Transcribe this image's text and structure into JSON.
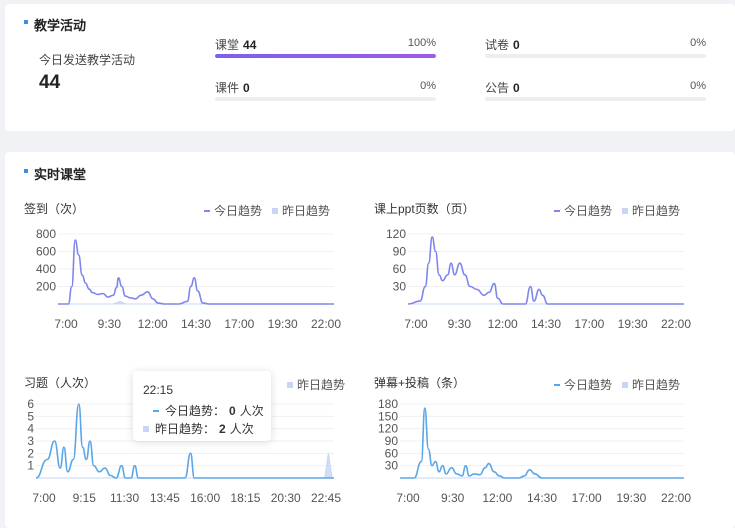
{
  "activity": {
    "title": "教学活动",
    "total_label": "今日发送教学活动",
    "total_value": "44",
    "stats": [
      {
        "label": "课堂",
        "value": "44",
        "percent": "100%",
        "fill": 1.0
      },
      {
        "label": "课件",
        "value": "0",
        "percent": "0%",
        "fill": 0
      },
      {
        "label": "试卷",
        "value": "0",
        "percent": "0%",
        "fill": 0
      },
      {
        "label": "公告",
        "value": "0",
        "percent": "0%",
        "fill": 0
      }
    ]
  },
  "live": {
    "title": "实时课堂"
  },
  "legend": {
    "today": "今日趋势",
    "yesterday": "昨日趋势"
  },
  "colors": {
    "purple": "#7f86ec",
    "blue": "#5aa6e8",
    "yesterday": "#c7d6f4",
    "bar_fill": "#8b5cf6"
  },
  "tooltip": {
    "time": "22:15",
    "today_label": "今日趋势：",
    "today_value": "0",
    "yesterday_label": "昨日趋势：",
    "yesterday_value": "2",
    "unit": "人次"
  },
  "chart_data": [
    {
      "type": "line",
      "title": "签到（次）",
      "series": [
        {
          "name": "今日趋势",
          "color": "#7f86ec"
        },
        {
          "name": "昨日趋势",
          "color": "#c7d6f4"
        }
      ],
      "y_ticks": [
        "800",
        "600",
        "400",
        "200"
      ],
      "ylim": [
        0,
        800
      ],
      "x_ticks": [
        "7:00",
        "9:30",
        "12:00",
        "14:30",
        "17:00",
        "19:30",
        "22:00"
      ],
      "today": [
        [
          7.0,
          0
        ],
        [
          7.6,
          0
        ],
        [
          7.8,
          200
        ],
        [
          8.0,
          730
        ],
        [
          8.2,
          560
        ],
        [
          8.4,
          330
        ],
        [
          8.6,
          240
        ],
        [
          8.8,
          170
        ],
        [
          9.0,
          130
        ],
        [
          9.3,
          110
        ],
        [
          9.6,
          120
        ],
        [
          9.9,
          80
        ],
        [
          10.2,
          100
        ],
        [
          10.4,
          190
        ],
        [
          10.5,
          300
        ],
        [
          10.7,
          200
        ],
        [
          10.9,
          90
        ],
        [
          11.2,
          70
        ],
        [
          11.5,
          60
        ],
        [
          11.8,
          100
        ],
        [
          12.2,
          140
        ],
        [
          12.5,
          60
        ],
        [
          12.8,
          10
        ],
        [
          13.2,
          0
        ],
        [
          14.0,
          0
        ],
        [
          14.5,
          30
        ],
        [
          14.7,
          200
        ],
        [
          14.9,
          300
        ],
        [
          15.1,
          150
        ],
        [
          15.4,
          10
        ],
        [
          15.8,
          0
        ],
        [
          23.0,
          0
        ]
      ],
      "yesterday": [
        [
          7.0,
          0
        ],
        [
          10.2,
          0
        ],
        [
          10.6,
          30
        ],
        [
          10.9,
          0
        ],
        [
          23.0,
          0
        ]
      ]
    },
    {
      "type": "line",
      "title": "课上ppt页数（页）",
      "series": [
        {
          "name": "今日趋势",
          "color": "#7f86ec"
        },
        {
          "name": "昨日趋势",
          "color": "#c7d6f4"
        }
      ],
      "y_ticks": [
        "120",
        "90",
        "60",
        "30"
      ],
      "ylim": [
        0,
        120
      ],
      "x_ticks": [
        "7:00",
        "9:30",
        "12:00",
        "14:30",
        "17:00",
        "19:30",
        "22:00"
      ],
      "today": [
        [
          7.0,
          0
        ],
        [
          7.7,
          5
        ],
        [
          8.0,
          30
        ],
        [
          8.2,
          70
        ],
        [
          8.4,
          115
        ],
        [
          8.6,
          90
        ],
        [
          8.8,
          50
        ],
        [
          9.0,
          40
        ],
        [
          9.3,
          50
        ],
        [
          9.5,
          70
        ],
        [
          9.7,
          50
        ],
        [
          10.0,
          70
        ],
        [
          10.3,
          50
        ],
        [
          10.6,
          30
        ],
        [
          11.0,
          25
        ],
        [
          11.4,
          15
        ],
        [
          11.7,
          20
        ],
        [
          12.0,
          35
        ],
        [
          12.2,
          10
        ],
        [
          12.5,
          0
        ],
        [
          13.8,
          0
        ],
        [
          14.1,
          30
        ],
        [
          14.3,
          5
        ],
        [
          14.6,
          25
        ],
        [
          14.8,
          15
        ],
        [
          15.1,
          0
        ],
        [
          23.0,
          0
        ]
      ],
      "yesterday": [
        [
          7.0,
          0
        ],
        [
          23.0,
          0
        ]
      ]
    },
    {
      "type": "line",
      "title": "习题（人次）",
      "series": [
        {
          "name": "昨日趋势",
          "color": "#c7d6f4"
        }
      ],
      "y_ticks": [
        "6",
        "5",
        "4",
        "3",
        "2",
        "1"
      ],
      "ylim": [
        0,
        6
      ],
      "x_ticks": [
        "7:00",
        "9:15",
        "11:30",
        "13:45",
        "16:00",
        "18:15",
        "20:30",
        "22:45"
      ],
      "today": [
        [
          7.0,
          0
        ],
        [
          7.6,
          1.5
        ],
        [
          8.0,
          3.0
        ],
        [
          8.3,
          0.8
        ],
        [
          8.5,
          2.5
        ],
        [
          8.7,
          0.5
        ],
        [
          9.0,
          1.5
        ],
        [
          9.3,
          6.0
        ],
        [
          9.5,
          2.5
        ],
        [
          9.7,
          1.5
        ],
        [
          9.9,
          3.0
        ],
        [
          10.1,
          1.0
        ],
        [
          10.4,
          0.5
        ],
        [
          10.7,
          0.8
        ],
        [
          11.0,
          0.2
        ],
        [
          11.3,
          0
        ],
        [
          11.6,
          1.0
        ],
        [
          11.8,
          0
        ],
        [
          12.1,
          0
        ],
        [
          12.3,
          1.0
        ],
        [
          12.5,
          0
        ],
        [
          15.0,
          0
        ],
        [
          15.3,
          2.0
        ],
        [
          15.5,
          0
        ],
        [
          23.0,
          0
        ]
      ],
      "yesterday": [
        [
          7.0,
          0
        ],
        [
          22.5,
          0
        ],
        [
          22.7,
          2.0
        ],
        [
          22.9,
          0
        ],
        [
          23.0,
          0
        ]
      ]
    },
    {
      "type": "line",
      "title": "弹幕+投稿（条）",
      "series": [
        {
          "name": "今日趋势",
          "color": "#5aa6e8"
        },
        {
          "name": "昨日趋势",
          "color": "#c7d6f4"
        }
      ],
      "y_ticks": [
        "180",
        "150",
        "120",
        "90",
        "60",
        "30"
      ],
      "ylim": [
        0,
        180
      ],
      "x_ticks": [
        "7:00",
        "9:30",
        "12:00",
        "14:30",
        "17:00",
        "19:30",
        "22:00"
      ],
      "today": [
        [
          7.0,
          0
        ],
        [
          7.8,
          0
        ],
        [
          8.2,
          40
        ],
        [
          8.4,
          170
        ],
        [
          8.6,
          70
        ],
        [
          8.8,
          30
        ],
        [
          9.0,
          40
        ],
        [
          9.2,
          15
        ],
        [
          9.4,
          30
        ],
        [
          9.6,
          10
        ],
        [
          9.9,
          25
        ],
        [
          10.2,
          10
        ],
        [
          10.5,
          5
        ],
        [
          10.7,
          30
        ],
        [
          10.9,
          5
        ],
        [
          11.2,
          10
        ],
        [
          11.5,
          8
        ],
        [
          11.8,
          25
        ],
        [
          12.0,
          35
        ],
        [
          12.3,
          15
        ],
        [
          12.6,
          5
        ],
        [
          12.9,
          0
        ],
        [
          13.7,
          0
        ],
        [
          14.0,
          5
        ],
        [
          14.3,
          20
        ],
        [
          14.6,
          10
        ],
        [
          15.0,
          0
        ],
        [
          23.0,
          0
        ]
      ],
      "yesterday": [
        [
          7.0,
          0
        ],
        [
          23.0,
          0
        ]
      ]
    }
  ]
}
